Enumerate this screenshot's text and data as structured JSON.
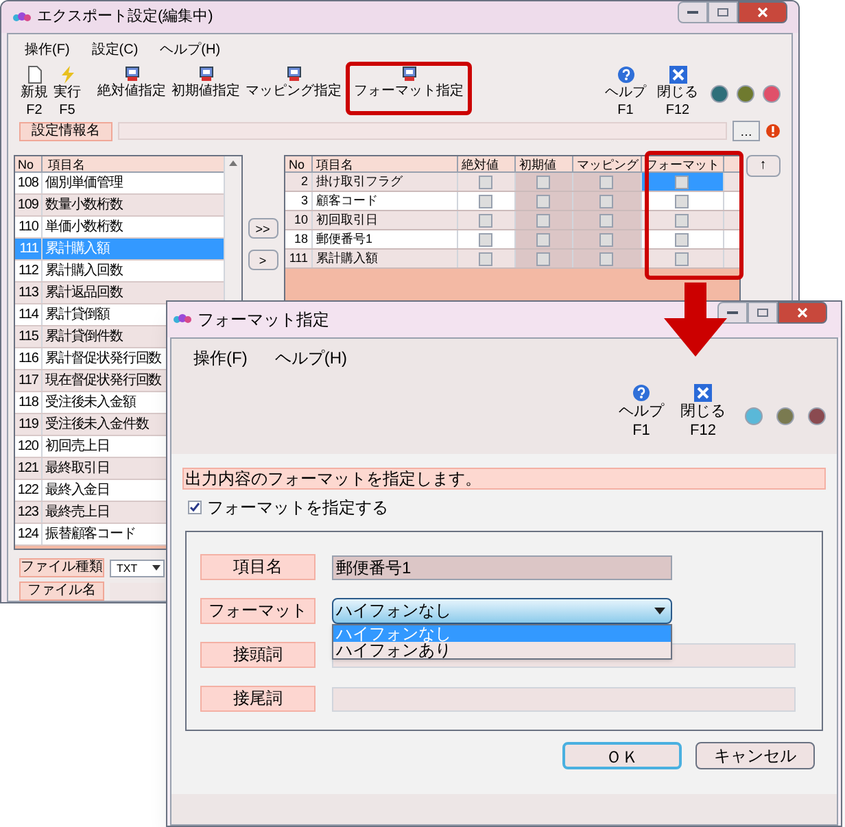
{
  "main_window": {
    "title": "エクスポート設定(編集中)",
    "menu": [
      "操作(F)",
      "設定(C)",
      "ヘルプ(H)"
    ],
    "toolbar": [
      {
        "kind": "new",
        "label": "新規",
        "key": "F2"
      },
      {
        "kind": "run",
        "label": "実行",
        "key": "F5"
      },
      {
        "kind": "spec",
        "label": "絶対値指定"
      },
      {
        "kind": "spec",
        "label": "初期値指定"
      },
      {
        "kind": "spec",
        "label": "マッピング指定"
      },
      {
        "kind": "spec",
        "label": "フォーマット指定"
      }
    ],
    "right_buttons": [
      {
        "kind": "help",
        "label": "ヘルプ",
        "key": "F1"
      },
      {
        "kind": "close",
        "label": "閉じる",
        "key": "F12"
      }
    ],
    "lights": [
      {
        "color": "#2f6f7a"
      },
      {
        "color": "#6f7a2f"
      },
      {
        "color": "#e0506a"
      }
    ],
    "settings_name_label": "設定情報名",
    "browse_button": "…",
    "left_list": {
      "columns": [
        "No",
        "項目名"
      ],
      "rows": [
        {
          "no": "108",
          "name": "個別単価管理",
          "selected": false
        },
        {
          "no": "109",
          "name": "数量小数桁数",
          "selected": false
        },
        {
          "no": "110",
          "name": "単価小数桁数",
          "selected": false
        },
        {
          "no": "111",
          "name": "累計購入額",
          "selected": true
        },
        {
          "no": "112",
          "name": "累計購入回数",
          "selected": false
        },
        {
          "no": "113",
          "name": "累計返品回数",
          "selected": false
        },
        {
          "no": "114",
          "name": "累計貸倒額",
          "selected": false
        },
        {
          "no": "115",
          "name": "累計貸倒件数",
          "selected": false
        },
        {
          "no": "116",
          "name": "累計督促状発行回数",
          "selected": false
        },
        {
          "no": "117",
          "name": "現在督促状発行回数",
          "selected": false
        },
        {
          "no": "118",
          "name": "受注後未入金額",
          "selected": false
        },
        {
          "no": "119",
          "name": "受注後未入金件数",
          "selected": false
        },
        {
          "no": "120",
          "name": "初回売上日",
          "selected": false
        },
        {
          "no": "121",
          "name": "最終取引日",
          "selected": false
        },
        {
          "no": "122",
          "name": "最終入金日",
          "selected": false
        },
        {
          "no": "123",
          "name": "最終売上日",
          "selected": false
        },
        {
          "no": "124",
          "name": "振替顧客コード",
          "selected": false
        }
      ]
    },
    "transfer_buttons": [
      ">>",
      ">"
    ],
    "right_table": {
      "columns": [
        "No",
        "項目名",
        "絶対値",
        "初期値",
        "マッピング",
        "フォーマット"
      ],
      "rows": [
        {
          "no": "2",
          "name": "掛け取引フラグ",
          "absolute": false,
          "initial": false,
          "mapping": false,
          "format": false,
          "selected": true
        },
        {
          "no": "3",
          "name": "顧客コード",
          "absolute": false,
          "initial": false,
          "mapping": false,
          "format": false,
          "selected": false
        },
        {
          "no": "10",
          "name": "初回取引日",
          "absolute": false,
          "initial": false,
          "mapping": false,
          "format": false,
          "selected": false
        },
        {
          "no": "18",
          "name": "郵便番号1",
          "absolute": false,
          "initial": false,
          "mapping": false,
          "format": false,
          "selected": false
        },
        {
          "no": "111",
          "name": "累計購入額",
          "absolute": false,
          "initial": false,
          "mapping": false,
          "format": false,
          "selected": false
        }
      ]
    },
    "up_button": "↑",
    "file_type_label": "ファイル種類",
    "file_type": "TXT",
    "file_name_label": "ファイル名"
  },
  "dialog": {
    "title": "フォーマット指定",
    "menu": [
      "操作(F)",
      "ヘルプ(H)"
    ],
    "right_buttons": [
      {
        "kind": "help",
        "label": "ヘルプ",
        "key": "F1"
      },
      {
        "kind": "close",
        "label": "閉じる",
        "key": "F12"
      }
    ],
    "lights": [
      {
        "color": "#5ab8d8"
      },
      {
        "color": "#7a7a50"
      },
      {
        "color": "#8a4a50"
      }
    ],
    "description": "出力内容のフォーマットを指定します。",
    "format_checkbox": {
      "label": "フォーマットを指定する",
      "checked": true
    },
    "item_name": {
      "label": "項目名",
      "value": "郵便番号1"
    },
    "format": {
      "label": "フォーマット",
      "value": "ハイフォンなし",
      "options": [
        {
          "label": "ハイフォンなし",
          "selected": true
        },
        {
          "label": "ハイフォンあり",
          "selected": false
        }
      ]
    },
    "prefix_label": "接頭詞",
    "suffix_label": "接尾詞",
    "ok": "ＯＫ",
    "cancel": "キャンセル"
  }
}
